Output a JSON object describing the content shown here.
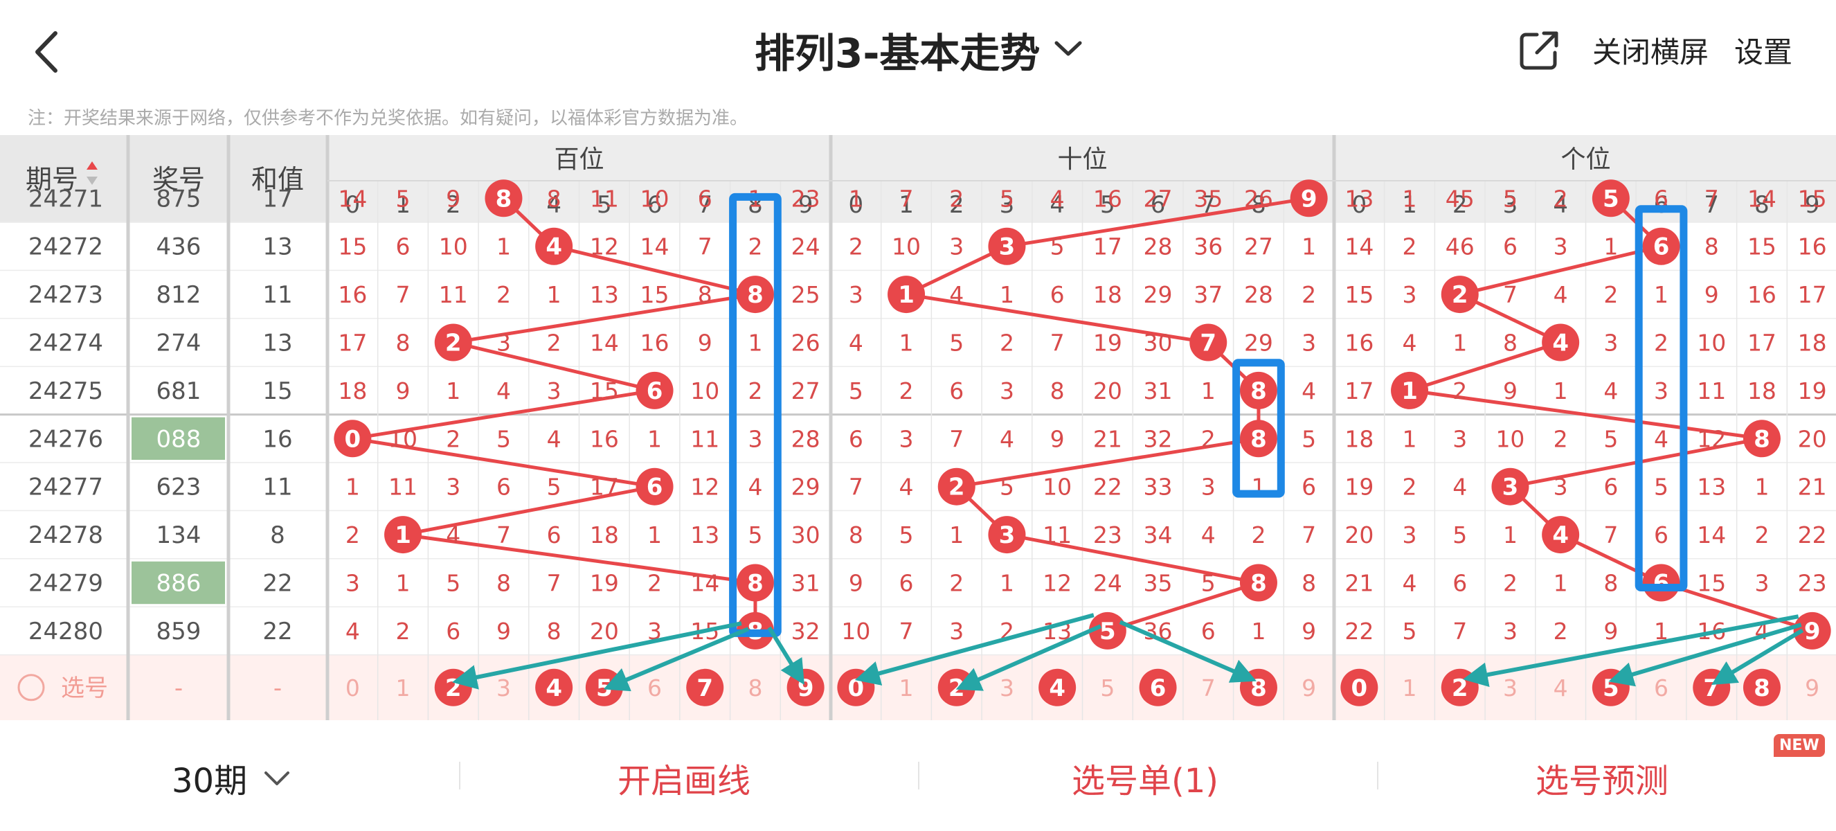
{
  "header": {
    "title": "排列3-基本走势",
    "close_landscape": "关闭横屏",
    "settings": "设置"
  },
  "note": "注：开奖结果来源于网络，仅供参考不作为兑奖依据。如有疑问，以福体彩官方数据为准。",
  "table": {
    "col_issue": "期号",
    "col_number": "奖号",
    "col_sum": "和值",
    "groups": [
      "百位",
      "十位",
      "个位"
    ],
    "digits": [
      "0",
      "1",
      "2",
      "3",
      "4",
      "5",
      "6",
      "7",
      "8",
      "9"
    ],
    "partial_row": {
      "issue": "24271",
      "number": "875",
      "sum": "17",
      "g": [
        [
          14,
          5,
          9,
          "8",
          8,
          11,
          10,
          6,
          1,
          23
        ],
        [
          1,
          7,
          2,
          5,
          4,
          16,
          27,
          35,
          26,
          "9"
        ],
        [
          13,
          1,
          45,
          5,
          2,
          "5",
          6,
          7,
          14,
          15
        ]
      ]
    },
    "rows": [
      {
        "issue": "24272",
        "number": "436",
        "sum": "13",
        "highlight": false,
        "g": [
          [
            15,
            6,
            10,
            1,
            "4",
            12,
            14,
            7,
            2,
            24
          ],
          [
            2,
            10,
            3,
            "3",
            5,
            17,
            28,
            36,
            27,
            1
          ],
          [
            14,
            2,
            46,
            6,
            3,
            1,
            "6",
            8,
            15,
            16
          ]
        ]
      },
      {
        "issue": "24273",
        "number": "812",
        "sum": "11",
        "highlight": false,
        "g": [
          [
            16,
            7,
            11,
            2,
            1,
            13,
            15,
            8,
            "8",
            25
          ],
          [
            3,
            "1",
            4,
            1,
            6,
            18,
            29,
            37,
            28,
            2
          ],
          [
            15,
            3,
            "2",
            7,
            4,
            2,
            1,
            9,
            16,
            17
          ]
        ]
      },
      {
        "issue": "24274",
        "number": "274",
        "sum": "13",
        "highlight": false,
        "g": [
          [
            17,
            8,
            "2",
            3,
            2,
            14,
            16,
            9,
            1,
            26
          ],
          [
            4,
            1,
            5,
            2,
            7,
            19,
            30,
            "7",
            29,
            3
          ],
          [
            16,
            4,
            1,
            8,
            "4",
            3,
            2,
            10,
            17,
            18
          ]
        ]
      },
      {
        "issue": "24275",
        "number": "681",
        "sum": "15",
        "highlight": false,
        "g": [
          [
            18,
            9,
            1,
            4,
            3,
            15,
            "6",
            10,
            2,
            27
          ],
          [
            5,
            2,
            6,
            3,
            8,
            20,
            31,
            1,
            "8",
            4
          ],
          [
            17,
            "1",
            2,
            9,
            1,
            4,
            3,
            11,
            18,
            19
          ]
        ]
      },
      {
        "issue": "24276",
        "number": "088",
        "sum": "16",
        "highlight": true,
        "g": [
          [
            "0",
            10,
            2,
            5,
            4,
            16,
            1,
            11,
            3,
            28
          ],
          [
            6,
            3,
            7,
            4,
            9,
            21,
            32,
            2,
            "8",
            5
          ],
          [
            18,
            1,
            3,
            10,
            2,
            5,
            4,
            12,
            "8",
            20
          ]
        ]
      },
      {
        "issue": "24277",
        "number": "623",
        "sum": "11",
        "highlight": false,
        "g": [
          [
            1,
            11,
            3,
            6,
            5,
            17,
            "6",
            12,
            4,
            29
          ],
          [
            7,
            4,
            "2",
            5,
            10,
            22,
            33,
            3,
            1,
            6
          ],
          [
            19,
            2,
            4,
            "3",
            3,
            6,
            5,
            13,
            1,
            21
          ]
        ]
      },
      {
        "issue": "24278",
        "number": "134",
        "sum": "8",
        "highlight": false,
        "g": [
          [
            2,
            "1",
            4,
            7,
            6,
            18,
            1,
            13,
            5,
            30
          ],
          [
            8,
            5,
            1,
            "3",
            11,
            23,
            34,
            4,
            2,
            7
          ],
          [
            20,
            3,
            5,
            1,
            "4",
            7,
            6,
            14,
            2,
            22
          ]
        ]
      },
      {
        "issue": "24279",
        "number": "886",
        "sum": "22",
        "highlight": true,
        "g": [
          [
            3,
            1,
            5,
            8,
            7,
            19,
            2,
            14,
            "8",
            31
          ],
          [
            9,
            6,
            2,
            1,
            12,
            24,
            35,
            5,
            "8",
            8
          ],
          [
            21,
            4,
            6,
            2,
            1,
            8,
            "6",
            15,
            3,
            23
          ]
        ]
      },
      {
        "issue": "24280",
        "number": "859",
        "sum": "22",
        "highlight": false,
        "g": [
          [
            4,
            2,
            6,
            9,
            8,
            20,
            3,
            15,
            "8",
            32
          ],
          [
            10,
            7,
            3,
            2,
            13,
            "5",
            36,
            6,
            1,
            9
          ],
          [
            22,
            5,
            7,
            3,
            2,
            9,
            1,
            16,
            4,
            "9"
          ]
        ]
      }
    ],
    "select_row": {
      "label": "选号",
      "number": "-",
      "sum": "-",
      "selected": [
        [
          2,
          4,
          5,
          7,
          9
        ],
        [
          0,
          2,
          4,
          6,
          8
        ],
        [
          0,
          2,
          5,
          7,
          8
        ]
      ]
    }
  },
  "bottom": {
    "period": "30期",
    "draw_line": "开启画线",
    "selection_list": "选号单(1)",
    "prediction": "选号预测",
    "new_badge": "NEW"
  },
  "colors": {
    "red": "#e8474a",
    "blue": "#1e88e5",
    "teal": "#26a6a6",
    "header_bg": "#ededed",
    "highlight_green": "#9cc39a",
    "select_row_bg": "#fff0ee"
  },
  "icons": {
    "back": "chevron-left-icon",
    "title_dropdown": "chevron-down-icon",
    "share": "external-link-icon",
    "sort": "sort-icon",
    "select_circle": "circle-icon",
    "period_dropdown": "chevron-down-icon"
  }
}
